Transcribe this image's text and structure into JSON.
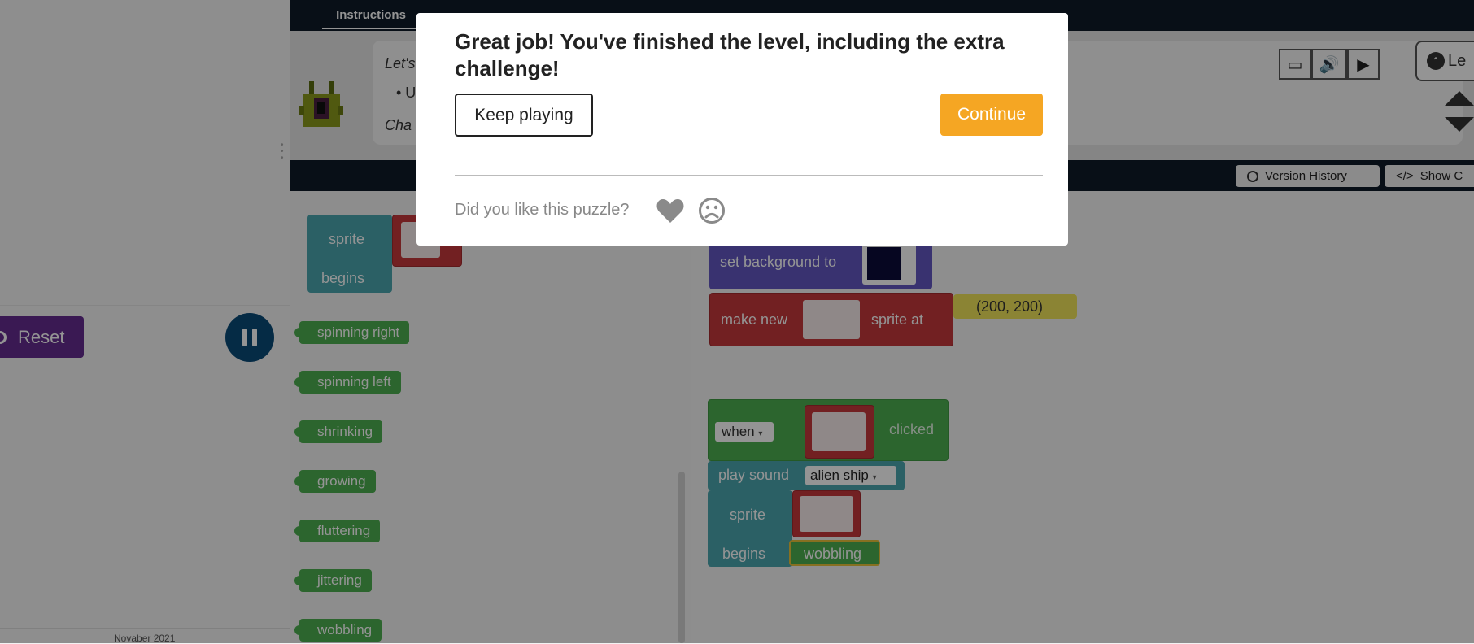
{
  "colors": {
    "header_dark": "#0e1b29",
    "reset_purple": "#652b8f",
    "pause_blue": "#0a4a78",
    "continue_orange": "#f5a623",
    "block_teal": "#4aa5ae",
    "block_green": "#4caf50",
    "block_red": "#c4373b",
    "block_purple": "#6257c2",
    "block_yellow": "#efe45a"
  },
  "header": {
    "tabs": [
      {
        "label": "Instructions"
      }
    ]
  },
  "instructions": {
    "line1": "Let's",
    "line2": "• U",
    "line3": "Cha"
  },
  "toolbar": {
    "level_label": "Le",
    "version_history_label": "Version History",
    "show_code_label": "Show C"
  },
  "game": {
    "reset_label": "Reset"
  },
  "footer": {
    "date_text": "Novaber 2021"
  },
  "toolbox": {
    "sprite_block": {
      "line1": "sprite",
      "line2": "begins"
    },
    "behaviors": [
      "spinning right",
      "spinning left",
      "shrinking",
      "growing",
      "fluttering",
      "jittering",
      "wobbling"
    ]
  },
  "workspace": {
    "set_background_label": "set background to",
    "make_new_label": "make new",
    "sprite_at_label": "sprite at",
    "location_value": "(200, 200)",
    "when_dropdown": "when",
    "clicked_label": "clicked",
    "play_sound_label": "play sound",
    "sound_value": "alien ship",
    "sprite_label": "sprite",
    "begins_label": "begins",
    "behavior_value": "wobbling"
  },
  "modal": {
    "title": "Great job! You've finished the level, including the extra challenge!",
    "keep_playing_label": "Keep playing",
    "continue_label": "Continue",
    "feedback_question": "Did you like this puzzle?",
    "like_icon": "heart-icon",
    "dislike_icon": "frown-icon"
  }
}
